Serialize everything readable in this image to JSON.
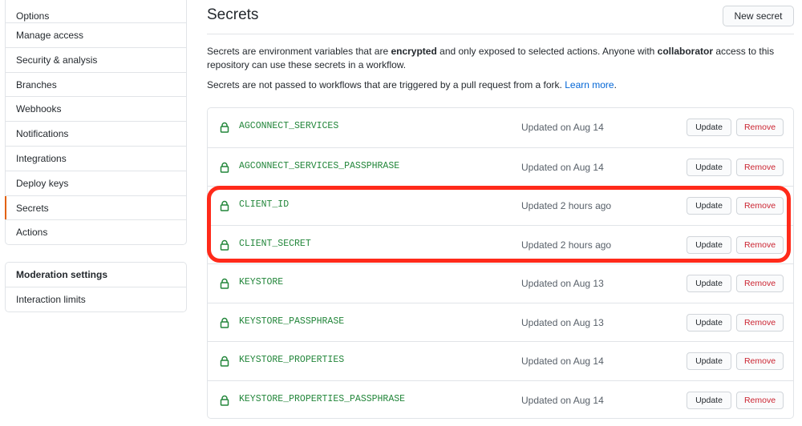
{
  "sidebar": {
    "items": [
      {
        "label": "Options"
      },
      {
        "label": "Manage access"
      },
      {
        "label": "Security & analysis"
      },
      {
        "label": "Branches"
      },
      {
        "label": "Webhooks"
      },
      {
        "label": "Notifications"
      },
      {
        "label": "Integrations"
      },
      {
        "label": "Deploy keys"
      },
      {
        "label": "Secrets",
        "selected": true
      },
      {
        "label": "Actions"
      }
    ],
    "moderation": {
      "heading": "Moderation settings",
      "items": [
        {
          "label": "Interaction limits"
        }
      ]
    }
  },
  "main": {
    "title": "Secrets",
    "new_secret_label": "New secret",
    "desc1_a": "Secrets are environment variables that are ",
    "desc1_b": "encrypted",
    "desc1_c": " and only exposed to selected actions. Anyone with ",
    "desc1_d": "collaborator",
    "desc1_e": " access to this repository can use these secrets in a workflow.",
    "desc2_a": "Secrets are not passed to workflows that are triggered by a pull request from a fork. ",
    "desc2_link": "Learn more",
    "desc2_end": "."
  },
  "secrets": [
    {
      "name": "AGCONNECT_SERVICES",
      "updated": "Updated on Aug 14",
      "update_label": "Update",
      "remove_label": "Remove"
    },
    {
      "name": "AGCONNECT_SERVICES_PASSPHRASE",
      "updated": "Updated on Aug 14",
      "update_label": "Update",
      "remove_label": "Remove"
    },
    {
      "name": "CLIENT_ID",
      "updated": "Updated 2 hours ago",
      "update_label": "Update",
      "remove_label": "Remove"
    },
    {
      "name": "CLIENT_SECRET",
      "updated": "Updated 2 hours ago",
      "update_label": "Update",
      "remove_label": "Remove"
    },
    {
      "name": "KEYSTORE",
      "updated": "Updated on Aug 13",
      "update_label": "Update",
      "remove_label": "Remove"
    },
    {
      "name": "KEYSTORE_PASSPHRASE",
      "updated": "Updated on Aug 13",
      "update_label": "Update",
      "remove_label": "Remove"
    },
    {
      "name": "KEYSTORE_PROPERTIES",
      "updated": "Updated on Aug 14",
      "update_label": "Update",
      "remove_label": "Remove"
    },
    {
      "name": "KEYSTORE_PROPERTIES_PASSPHRASE",
      "updated": "Updated on Aug 14",
      "update_label": "Update",
      "remove_label": "Remove"
    }
  ],
  "colors": {
    "accent_selected": "#e36209",
    "secret_name": "#22863a",
    "link": "#0366d6",
    "remove": "#cb2431",
    "highlight": "#ff2a1a"
  },
  "icons": {
    "secret": "lock-icon"
  }
}
